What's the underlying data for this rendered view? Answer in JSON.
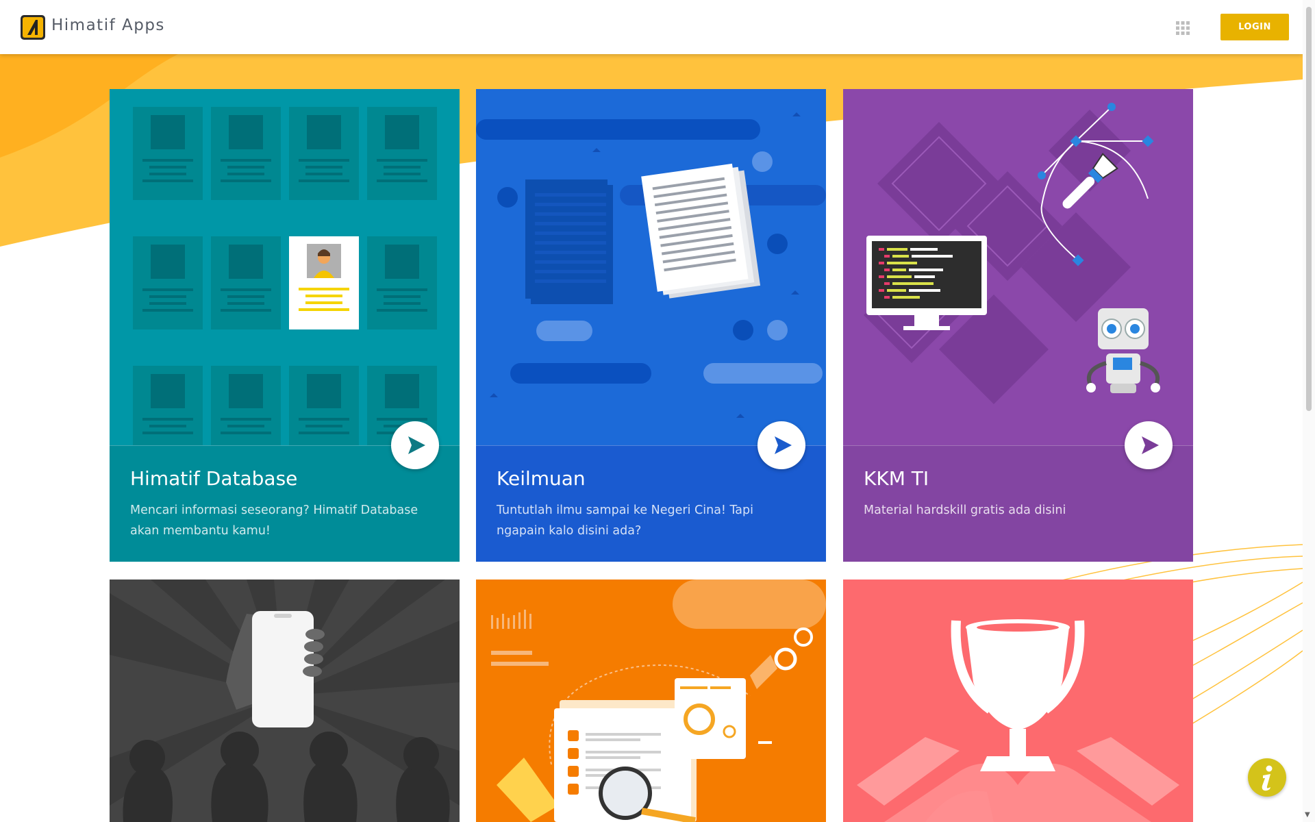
{
  "header": {
    "app_title": "Himatif Apps",
    "login_label": "LOGIN"
  },
  "cards": [
    {
      "title": "Himatif Database",
      "description": "Mencari informasi seseorang? Himatif Database akan membantu kamu!",
      "color": "#0097a7"
    },
    {
      "title": "Keilmuan",
      "description": "Tuntutlah ilmu sampai ke Negeri Cina! Tapi ngapain kalo disini ada?",
      "color": "#1e63d6"
    },
    {
      "title": "KKM TI",
      "description": "Material hardskill gratis ada disini",
      "color": "#8a45a8"
    },
    {
      "title": "",
      "description": "",
      "color": "#4a4a4a"
    },
    {
      "title": "",
      "description": "",
      "color": "#f57c00"
    },
    {
      "title": "",
      "description": "",
      "color": "#fd6a6e"
    }
  ],
  "icons": [
    "logo-icon",
    "apps-grid-icon",
    "play-icon",
    "info-icon"
  ],
  "colors": {
    "accent": "#e8b200",
    "background_swoosh": "#ffc23d"
  }
}
